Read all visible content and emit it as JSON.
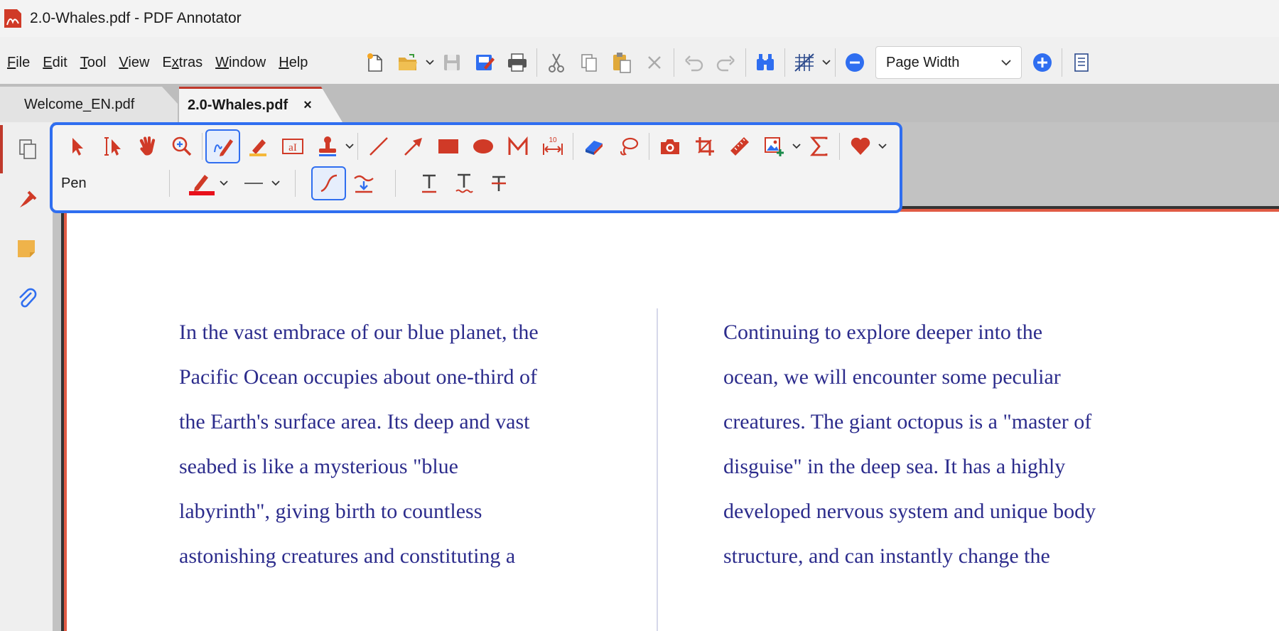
{
  "window": {
    "title": "2.0-Whales.pdf - PDF Annotator"
  },
  "menu": {
    "items": [
      {
        "label": "File",
        "accel": "F",
        "rest": "ile"
      },
      {
        "label": "Edit",
        "accel": "E",
        "rest": "dit"
      },
      {
        "label": "Tool",
        "accel": "T",
        "rest": "ool"
      },
      {
        "label": "View",
        "accel": "V",
        "rest": "iew"
      },
      {
        "label": "Extras",
        "accel_pre": "E",
        "accel": "x",
        "rest": "tras"
      },
      {
        "label": "Window",
        "accel": "W",
        "rest": "indow"
      },
      {
        "label": "Help",
        "accel": "H",
        "rest": "elp"
      }
    ]
  },
  "toolbar": {
    "zoom_value": "Page Width",
    "icons": [
      "new-document-icon",
      "open-folder-icon",
      "save-icon",
      "edit-save-icon",
      "print-icon",
      "cut-icon",
      "copy-icon",
      "paste-icon",
      "delete-icon",
      "undo-icon",
      "redo-icon",
      "binoculars-icon",
      "grid-icon",
      "zoom-out-icon",
      "zoom-in-icon",
      "page-view-icon"
    ]
  },
  "tabs": [
    {
      "label": "Welcome_EN.pdf",
      "active": false
    },
    {
      "label": "2.0-Whales.pdf",
      "active": true,
      "close": "×"
    }
  ],
  "annotation_toolbar": {
    "tool_name": "Pen",
    "measure_label": "10",
    "stamp_text": "aI",
    "accent_color": "#2f6ef0",
    "tool_color": "#d03a27",
    "pen_color": "#e8101b"
  },
  "document": {
    "left_column": [
      "In the vast embrace of our blue planet, the",
      "Pacific Ocean occupies about one-third of",
      "the Earth's surface area. Its deep and vast",
      "seabed is like a mysterious \"blue",
      "labyrinth\", giving birth to countless",
      "astonishing creatures and constituting a"
    ],
    "right_column": [
      "Continuing to explore deeper into the",
      "ocean, we will encounter some peculiar",
      "creatures. The giant octopus is a \"master of",
      "disguise\" in the deep sea. It has a highly",
      "developed nervous system and unique body",
      "structure, and can instantly change the"
    ],
    "text_color": "#2c2c8c"
  }
}
